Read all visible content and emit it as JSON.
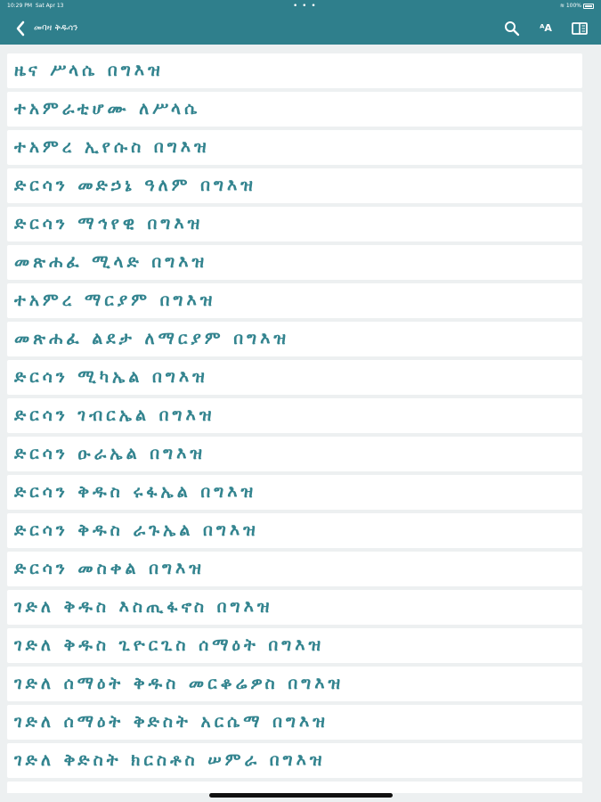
{
  "status_bar": {
    "time": "10:29 PM",
    "date": "Sat Apr 13",
    "dots": "• • •",
    "battery": "100%"
  },
  "nav": {
    "title": "መባዛ ቅዱሳን",
    "back_icon": "chevron-left-icon",
    "search_icon": "search-icon",
    "font_icon": "font-size-icon",
    "font_label": "ᴬA",
    "book_icon": "book-icon"
  },
  "colors": {
    "header": "#2f7f8c",
    "row_text": "#33848f",
    "background": "#edf0f1",
    "row_bg": "#ffffff"
  },
  "items": [
    "ዜና ሥላሴ በግእዝ",
    "ተአምራቲሆሙ ለሥላሴ",
    "ተአምረ ኢየሱስ በግእዝ",
    "ድርሳን መድኃኔ ዓለም በግእዝ",
    "ድርሳን ማኅየዊ በግእዝ",
    "መጽሐፈ ሚላድ በግእዝ",
    "ተአምረ ማርያም በግእዝ",
    "መጽሐፈ ልደታ ለማርያም በግእዝ",
    "ድርሳን ሚካኤል በግእዝ",
    "ድርሳን ገብርኤል በግእዝ",
    "ድርሳን ዑራኤል በግእዝ",
    "ድርሳን ቅዱስ ሩፋኤል በግእዝ",
    "ድርሳን ቅዱስ ራጉኤል በግእዝ",
    "ድርሳን መስቀል በግእዝ",
    "ገድለ ቅዱስ እስጢፋኖስ በግእዝ",
    "ገድለ ቅዱስ ጊዮርጊስ ሰማዕት በግእዝ",
    "ገድለ ሰማዕት ቅዱስ መርቆሬዎስ በግእዝ",
    "ገድለ ሰማዕት ቅድስት አርሴማ በግእዝ",
    "ገድለ ቅድስት ክርስቶስ ሠምራ በግእዝ"
  ]
}
